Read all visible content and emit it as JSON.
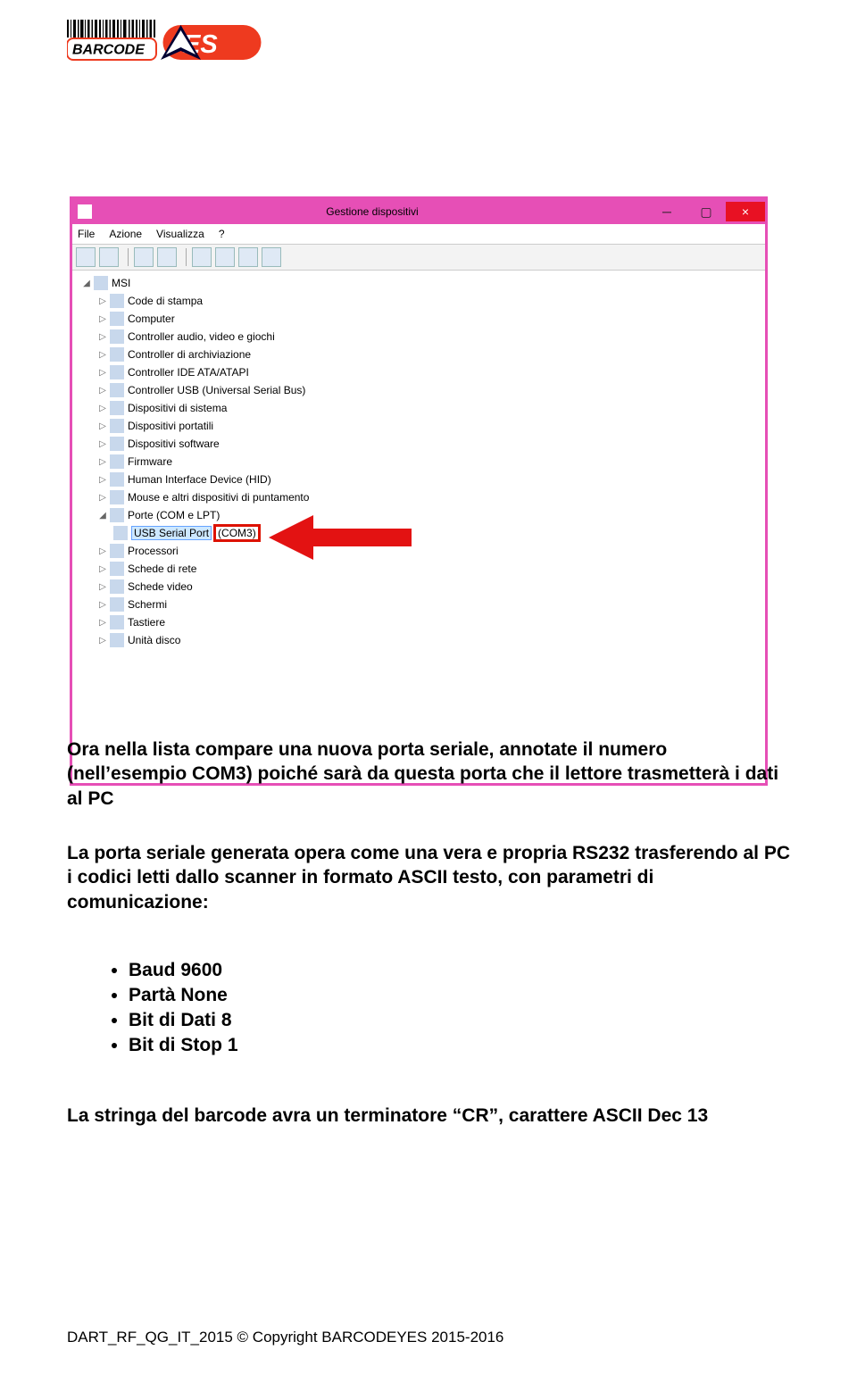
{
  "logo_alt": "BARCODE YES",
  "window": {
    "title": "Gestione dispositivi",
    "close_glyph": "×",
    "max_glyph": "▢",
    "min_glyph": "─"
  },
  "menubar": [
    "File",
    "Azione",
    "Visualizza",
    "?"
  ],
  "tree": {
    "root": "MSI",
    "items": [
      "Code di stampa",
      "Computer",
      "Controller audio, video e giochi",
      "Controller di archiviazione",
      "Controller IDE ATA/ATAPI",
      "Controller USB (Universal Serial Bus)",
      "Dispositivi di sistema",
      "Dispositivi portatili",
      "Dispositivi software",
      "Firmware",
      "Human Interface Device (HID)",
      "Mouse e altri dispositivi di puntamento"
    ],
    "ports_label": "Porte (COM e LPT)",
    "usb_serial_label": "USB Serial Port",
    "usb_serial_com": "(COM3)",
    "items_after": [
      "Processori",
      "Schede di rete",
      "Schede video",
      "Schermi",
      "Tastiere",
      "Unità disco"
    ]
  },
  "para1": "Ora nella lista compare una nuova porta seriale, annotate il numero (nell’esempio COM3) poiché sarà da questa porta che il lettore trasmetterà i dati al PC",
  "para2": "La porta seriale generata opera come una vera e propria RS232 trasferendo al PC i codici letti dallo scanner in formato ASCII testo, con parametri di comunicazione:",
  "bullets": [
    "Baud 9600",
    "Partà None",
    "Bit di Dati  8",
    "Bit di Stop 1"
  ],
  "para3": "La stringa del barcode avra un terminatore “CR”, carattere ASCII Dec  13",
  "footer": "DART_RF_QG_IT_2015   © Copyright  BARCODEYES 2015-2016"
}
